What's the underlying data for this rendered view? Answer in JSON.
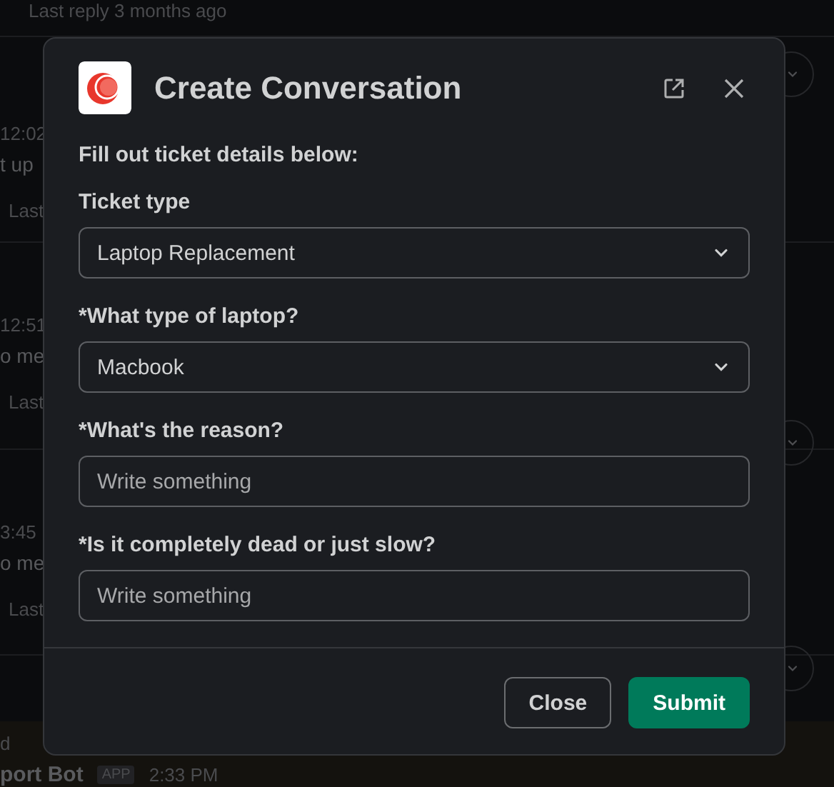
{
  "background": {
    "top_reply": "Last reply 3 months ago",
    "messages": [
      {
        "time": "12:02",
        "text": "t up",
        "reply": "Last"
      },
      {
        "time": "12:51",
        "text": "o me",
        "reply": "Last"
      },
      {
        "time": "3:45",
        "text": "o me",
        "reply": "Last"
      }
    ],
    "bottom": {
      "line": "d",
      "sender": "port Bot",
      "badge": "APP",
      "time": "2:33 PM"
    }
  },
  "modal": {
    "title": "Create Conversation",
    "intro": "Fill out ticket details below:",
    "fields": [
      {
        "kind": "select",
        "label": "Ticket type",
        "value": "Laptop Replacement"
      },
      {
        "kind": "select",
        "label": "*What type of laptop?",
        "value": "Macbook"
      },
      {
        "kind": "text",
        "label": "*What's the reason?",
        "placeholder": "Write something"
      },
      {
        "kind": "text",
        "label": "*Is it completely dead or just slow?",
        "placeholder": "Write something"
      }
    ],
    "buttons": [
      {
        "label": "Close",
        "kind": "secondary"
      },
      {
        "label": "Submit",
        "kind": "primary"
      }
    ]
  }
}
